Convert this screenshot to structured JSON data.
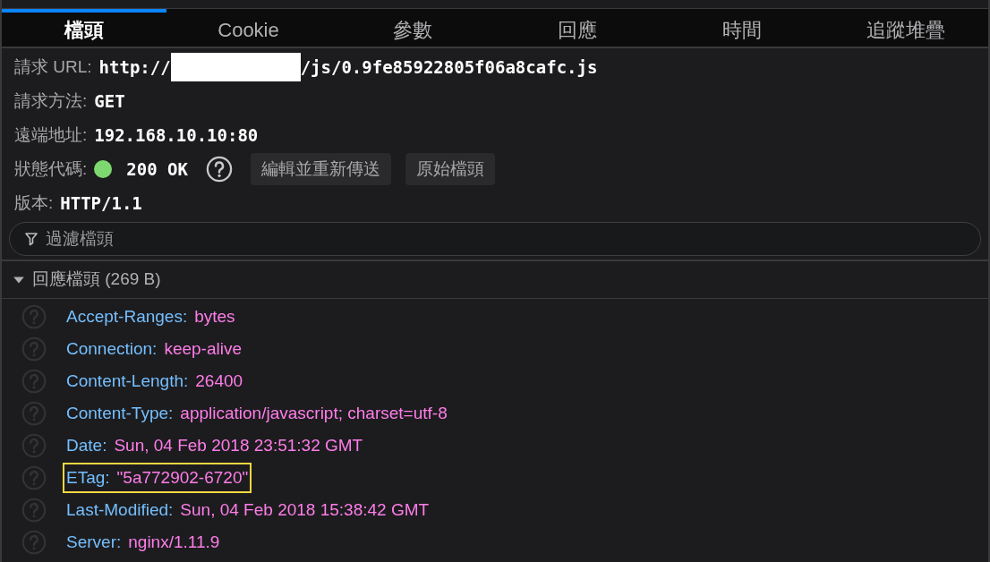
{
  "tabs": [
    {
      "label": "檔頭",
      "selected": true
    },
    {
      "label": "Cookie",
      "selected": false
    },
    {
      "label": "參數",
      "selected": false
    },
    {
      "label": "回應",
      "selected": false
    },
    {
      "label": "時間",
      "selected": false
    },
    {
      "label": "追蹤堆疊",
      "selected": false
    }
  ],
  "summary": [
    {
      "kind": "url",
      "label": "請求 URL:",
      "value_prefix": "http://",
      "redacted": true,
      "value": "/js/0.9fe85922805f06a8cafc.js"
    },
    {
      "kind": "text",
      "label": "請求方法:",
      "value": "GET"
    },
    {
      "kind": "text",
      "label": "遠端地址:",
      "value": "192.168.10.10:80"
    },
    {
      "kind": "status",
      "label": "狀態代碼:",
      "color": "#7dd96f",
      "value": "200 OK",
      "buttons": [
        "編輯並重新傳送",
        "原始檔頭"
      ]
    },
    {
      "kind": "text",
      "label": "版本:",
      "value": "HTTP/1.1"
    }
  ],
  "filter": {
    "placeholder": "過濾檔頭"
  },
  "response_headers": {
    "title": "回應檔頭 (269 B)",
    "expanded": true,
    "items": [
      {
        "name": "Accept-Ranges:",
        "value": "bytes",
        "highlighted": false
      },
      {
        "name": "Connection:",
        "value": "keep-alive",
        "highlighted": false
      },
      {
        "name": "Content-Length:",
        "value": "26400",
        "highlighted": false
      },
      {
        "name": "Content-Type:",
        "value": "application/javascript; charset=utf-8",
        "highlighted": false
      },
      {
        "name": "Date:",
        "value": "Sun, 04 Feb 2018 23:51:32 GMT",
        "highlighted": false
      },
      {
        "name": "ETag:",
        "value": "\"5a772902-6720\"",
        "highlighted": true
      },
      {
        "name": "Last-Modified:",
        "value": "Sun, 04 Feb 2018 15:38:42 GMT",
        "highlighted": false
      },
      {
        "name": "Server:",
        "value": "nginx/1.11.9",
        "highlighted": false
      }
    ]
  }
}
